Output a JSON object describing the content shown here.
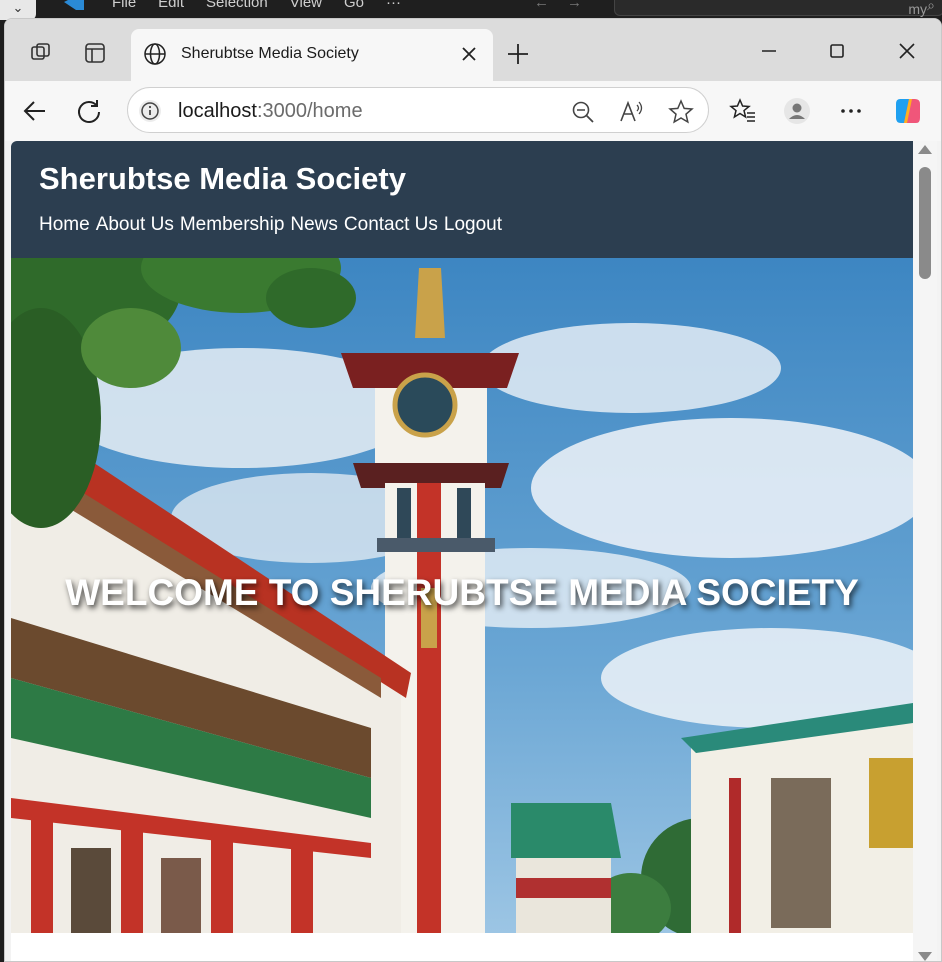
{
  "editor": {
    "menus": [
      "File",
      "Edit",
      "Selection",
      "View",
      "Go",
      "···"
    ],
    "search_hint": "my"
  },
  "browser": {
    "tab_title": "Sherubtse Media Society",
    "url_host": "localhost",
    "url_path": ":3000/home"
  },
  "site": {
    "title": "Sherubtse Media Society",
    "nav": [
      "Home",
      "About Us",
      "Membership",
      "News",
      "Contact Us",
      "Logout"
    ],
    "hero_heading": "WELCOME TO SHERUBTSE MEDIA SOCIETY"
  },
  "colors": {
    "header_bg": "#2c3e50",
    "sky": "#4a8fc4"
  }
}
